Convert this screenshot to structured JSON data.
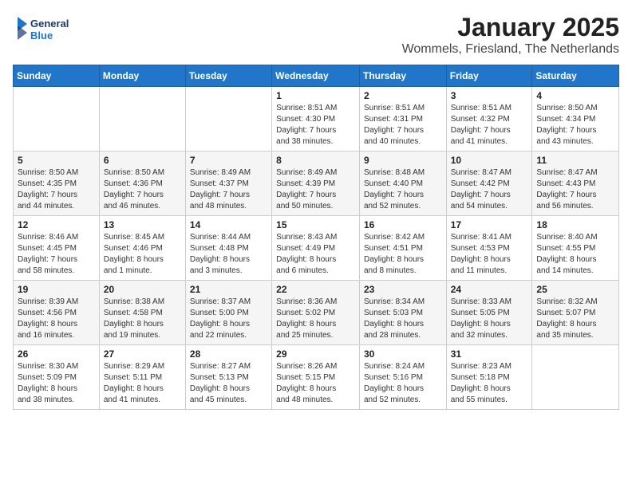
{
  "header": {
    "logo_general": "General",
    "logo_blue": "Blue",
    "month_title": "January 2025",
    "location": "Wommels, Friesland, The Netherlands"
  },
  "weekdays": [
    "Sunday",
    "Monday",
    "Tuesday",
    "Wednesday",
    "Thursday",
    "Friday",
    "Saturday"
  ],
  "weeks": [
    [
      {
        "day": "",
        "info": ""
      },
      {
        "day": "",
        "info": ""
      },
      {
        "day": "",
        "info": ""
      },
      {
        "day": "1",
        "info": "Sunrise: 8:51 AM\nSunset: 4:30 PM\nDaylight: 7 hours\nand 38 minutes."
      },
      {
        "day": "2",
        "info": "Sunrise: 8:51 AM\nSunset: 4:31 PM\nDaylight: 7 hours\nand 40 minutes."
      },
      {
        "day": "3",
        "info": "Sunrise: 8:51 AM\nSunset: 4:32 PM\nDaylight: 7 hours\nand 41 minutes."
      },
      {
        "day": "4",
        "info": "Sunrise: 8:50 AM\nSunset: 4:34 PM\nDaylight: 7 hours\nand 43 minutes."
      }
    ],
    [
      {
        "day": "5",
        "info": "Sunrise: 8:50 AM\nSunset: 4:35 PM\nDaylight: 7 hours\nand 44 minutes."
      },
      {
        "day": "6",
        "info": "Sunrise: 8:50 AM\nSunset: 4:36 PM\nDaylight: 7 hours\nand 46 minutes."
      },
      {
        "day": "7",
        "info": "Sunrise: 8:49 AM\nSunset: 4:37 PM\nDaylight: 7 hours\nand 48 minutes."
      },
      {
        "day": "8",
        "info": "Sunrise: 8:49 AM\nSunset: 4:39 PM\nDaylight: 7 hours\nand 50 minutes."
      },
      {
        "day": "9",
        "info": "Sunrise: 8:48 AM\nSunset: 4:40 PM\nDaylight: 7 hours\nand 52 minutes."
      },
      {
        "day": "10",
        "info": "Sunrise: 8:47 AM\nSunset: 4:42 PM\nDaylight: 7 hours\nand 54 minutes."
      },
      {
        "day": "11",
        "info": "Sunrise: 8:47 AM\nSunset: 4:43 PM\nDaylight: 7 hours\nand 56 minutes."
      }
    ],
    [
      {
        "day": "12",
        "info": "Sunrise: 8:46 AM\nSunset: 4:45 PM\nDaylight: 7 hours\nand 58 minutes."
      },
      {
        "day": "13",
        "info": "Sunrise: 8:45 AM\nSunset: 4:46 PM\nDaylight: 8 hours\nand 1 minute."
      },
      {
        "day": "14",
        "info": "Sunrise: 8:44 AM\nSunset: 4:48 PM\nDaylight: 8 hours\nand 3 minutes."
      },
      {
        "day": "15",
        "info": "Sunrise: 8:43 AM\nSunset: 4:49 PM\nDaylight: 8 hours\nand 6 minutes."
      },
      {
        "day": "16",
        "info": "Sunrise: 8:42 AM\nSunset: 4:51 PM\nDaylight: 8 hours\nand 8 minutes."
      },
      {
        "day": "17",
        "info": "Sunrise: 8:41 AM\nSunset: 4:53 PM\nDaylight: 8 hours\nand 11 minutes."
      },
      {
        "day": "18",
        "info": "Sunrise: 8:40 AM\nSunset: 4:55 PM\nDaylight: 8 hours\nand 14 minutes."
      }
    ],
    [
      {
        "day": "19",
        "info": "Sunrise: 8:39 AM\nSunset: 4:56 PM\nDaylight: 8 hours\nand 16 minutes."
      },
      {
        "day": "20",
        "info": "Sunrise: 8:38 AM\nSunset: 4:58 PM\nDaylight: 8 hours\nand 19 minutes."
      },
      {
        "day": "21",
        "info": "Sunrise: 8:37 AM\nSunset: 5:00 PM\nDaylight: 8 hours\nand 22 minutes."
      },
      {
        "day": "22",
        "info": "Sunrise: 8:36 AM\nSunset: 5:02 PM\nDaylight: 8 hours\nand 25 minutes."
      },
      {
        "day": "23",
        "info": "Sunrise: 8:34 AM\nSunset: 5:03 PM\nDaylight: 8 hours\nand 28 minutes."
      },
      {
        "day": "24",
        "info": "Sunrise: 8:33 AM\nSunset: 5:05 PM\nDaylight: 8 hours\nand 32 minutes."
      },
      {
        "day": "25",
        "info": "Sunrise: 8:32 AM\nSunset: 5:07 PM\nDaylight: 8 hours\nand 35 minutes."
      }
    ],
    [
      {
        "day": "26",
        "info": "Sunrise: 8:30 AM\nSunset: 5:09 PM\nDaylight: 8 hours\nand 38 minutes."
      },
      {
        "day": "27",
        "info": "Sunrise: 8:29 AM\nSunset: 5:11 PM\nDaylight: 8 hours\nand 41 minutes."
      },
      {
        "day": "28",
        "info": "Sunrise: 8:27 AM\nSunset: 5:13 PM\nDaylight: 8 hours\nand 45 minutes."
      },
      {
        "day": "29",
        "info": "Sunrise: 8:26 AM\nSunset: 5:15 PM\nDaylight: 8 hours\nand 48 minutes."
      },
      {
        "day": "30",
        "info": "Sunrise: 8:24 AM\nSunset: 5:16 PM\nDaylight: 8 hours\nand 52 minutes."
      },
      {
        "day": "31",
        "info": "Sunrise: 8:23 AM\nSunset: 5:18 PM\nDaylight: 8 hours\nand 55 minutes."
      },
      {
        "day": "",
        "info": ""
      }
    ]
  ]
}
